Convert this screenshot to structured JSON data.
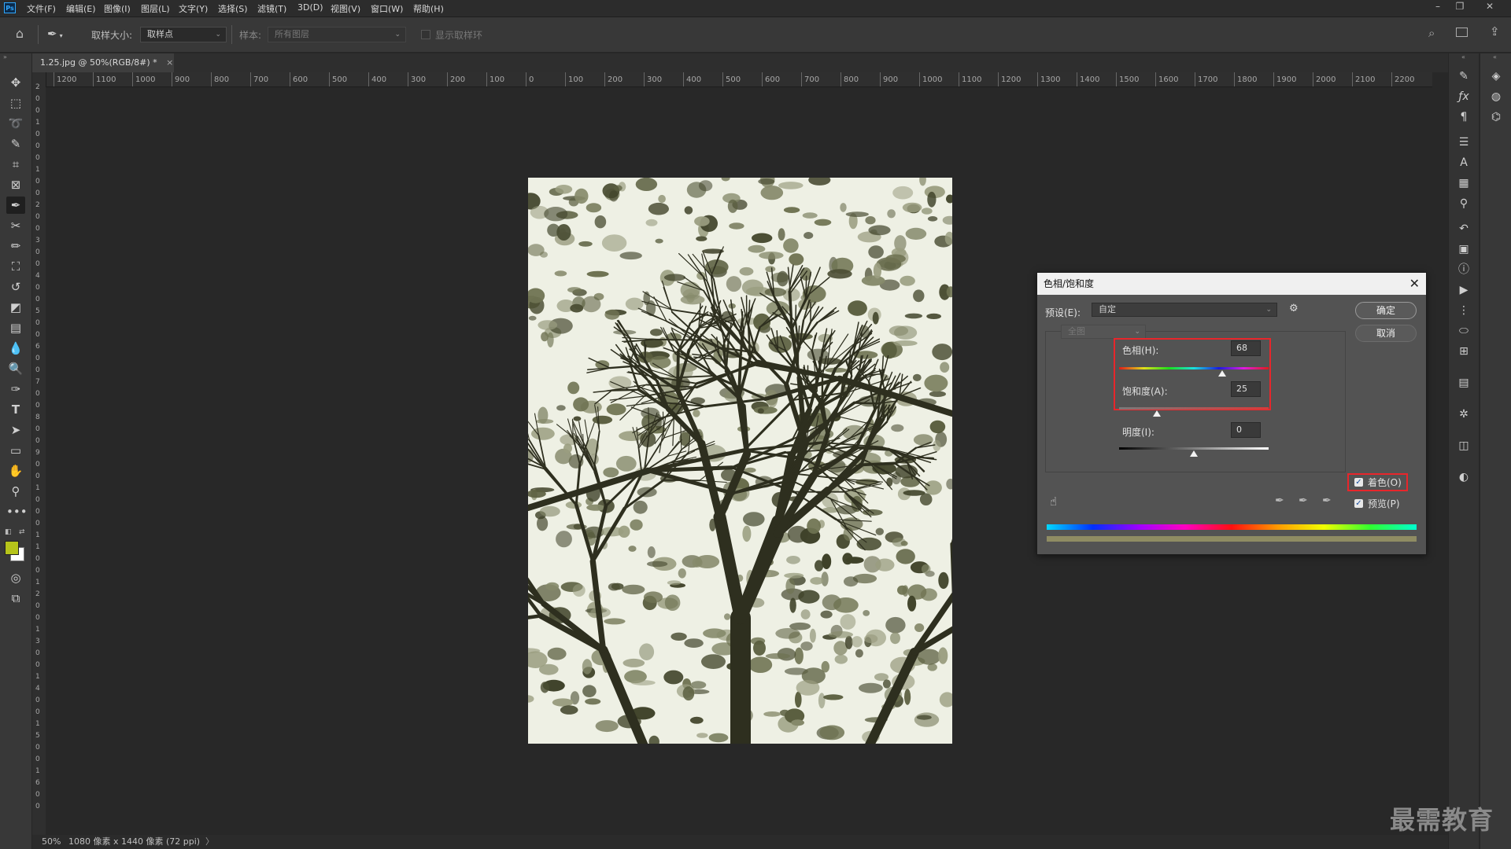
{
  "menubar": {
    "app_icon": "Ps",
    "items": [
      "文件(F)",
      "编辑(E)",
      "图像(I)",
      "图层(L)",
      "文字(Y)",
      "选择(S)",
      "滤镜(T)",
      "3D(D)",
      "视图(V)",
      "窗口(W)",
      "帮助(H)"
    ],
    "window_controls": [
      "–",
      "❐",
      "✕"
    ]
  },
  "options": {
    "sample_size_label": "取样大小:",
    "sample_size_value": "取样点",
    "sample_label": "样本:",
    "sample_value": "所有图层",
    "show_ring_label": "显示取样环"
  },
  "document": {
    "tab_title": "1.25.jpg @ 50%(RGB/8#) *",
    "tab_close": "×"
  },
  "ruler": {
    "h_ticks": [
      "1200",
      "1100",
      "1000",
      "900",
      "800",
      "700",
      "600",
      "500",
      "400",
      "300",
      "200",
      "100",
      "0",
      "100",
      "200",
      "300",
      "400",
      "500",
      "600",
      "700",
      "800",
      "900",
      "1000",
      "1100",
      "1200",
      "1300",
      "1400",
      "1500",
      "1600",
      "1700",
      "1800",
      "1900",
      "2000",
      "2100",
      "2200"
    ],
    "v_ticks": [
      "2",
      "0",
      "0",
      "1",
      "0",
      "0",
      "0",
      "1",
      "0",
      "0",
      "2",
      "0",
      "0",
      "3",
      "0",
      "0",
      "4",
      "0",
      "0",
      "5",
      "0",
      "0",
      "6",
      "0",
      "0",
      "7",
      "0",
      "0",
      "8",
      "0",
      "0",
      "9",
      "0",
      "0",
      "1",
      "0",
      "0",
      "0",
      "1",
      "1",
      "0",
      "0",
      "1",
      "2",
      "0",
      "0",
      "1",
      "3",
      "0",
      "0",
      "1",
      "4",
      "0",
      "0",
      "1",
      "5",
      "0",
      "0",
      "1",
      "6",
      "0",
      "0"
    ]
  },
  "status": {
    "zoom": "50%",
    "info": "1080 像素 x 1440 像素 (72 ppi)",
    "arrow": "〉"
  },
  "dialog": {
    "title": "色相/饱和度",
    "preset_label": "预设(E):",
    "preset_value": "自定",
    "channel_value": "全图",
    "hue_label": "色相(H):",
    "hue_value": "68",
    "hue_level": 0.69,
    "saturation_label": "饱和度(A):",
    "saturation_value": "25",
    "saturation_level": 0.25,
    "lightness_label": "明度(I):",
    "lightness_value": "0",
    "lightness_level": 0.5,
    "ok_label": "确定",
    "cancel_label": "取消",
    "colorize_label": "着色(O)",
    "colorize_checked": true,
    "preview_label": "预览(P)",
    "preview_checked": true,
    "colorize_color": "#8f8c63",
    "highlight_color": "#e8262b"
  },
  "colors": {
    "foreground": "#b6c41a",
    "background": "#ffffff"
  },
  "watermark": "最需教育"
}
